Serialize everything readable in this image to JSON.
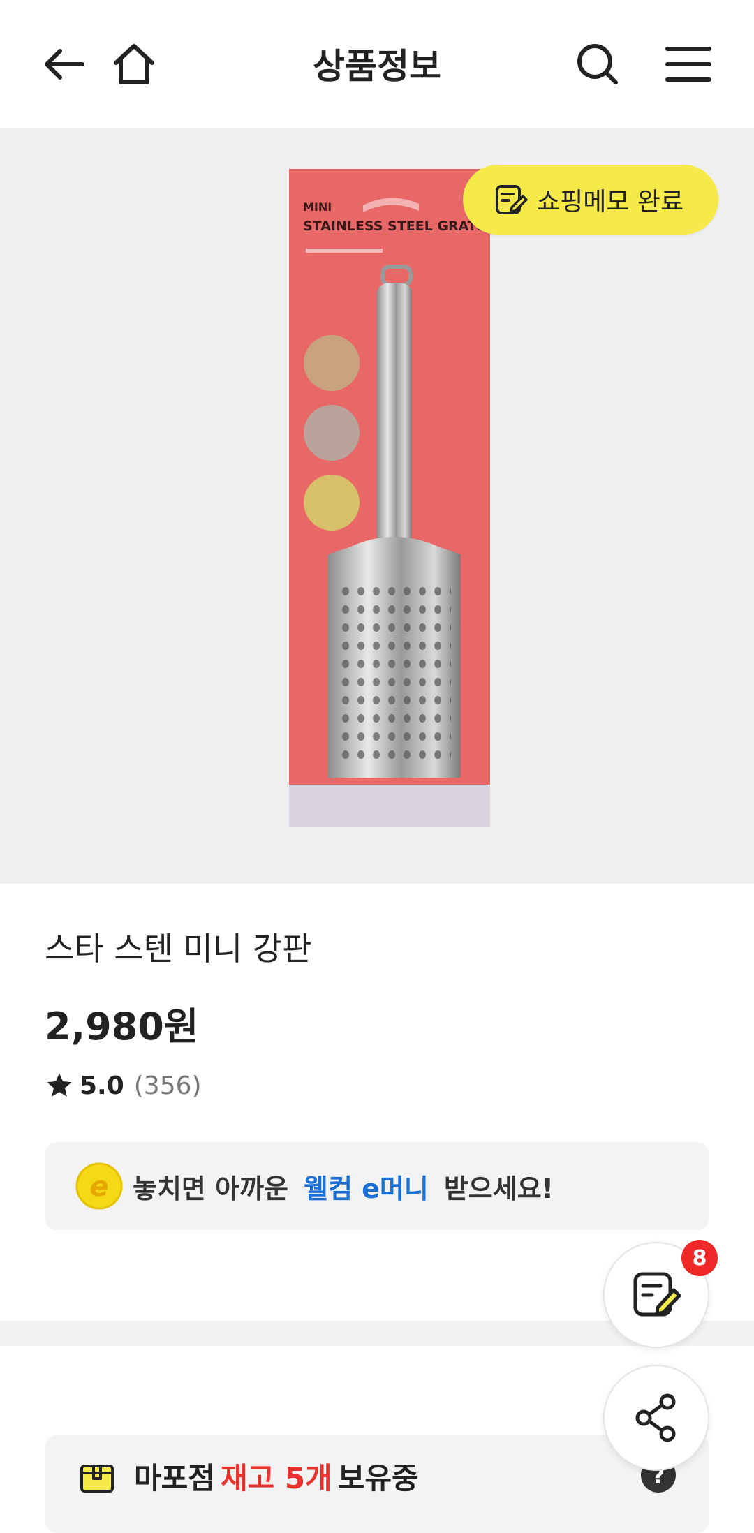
{
  "header": {
    "title": "상품정보",
    "back_icon": "arrow-left-icon",
    "home_icon": "home-icon",
    "search_icon": "search-icon",
    "menu_icon": "hamburger-menu-icon"
  },
  "hero": {
    "package_text_line1": "MINI",
    "package_text_line2": "STAINLESS STEEL GRATER",
    "memo_button_label": "쇼핑메모 완료",
    "memo_button_color": "#f6e94a"
  },
  "product": {
    "name": "스타 스텐 미니 강판",
    "price": "2,980원",
    "rating_score": "5.0",
    "rating_count": "(356)"
  },
  "welcome": {
    "coin_letter": "e",
    "text_before": "놓치면 아까운",
    "highlight": "웰컴 e머니",
    "text_after": "받으세요!",
    "highlight_color": "#1a6fd6"
  },
  "store": {
    "store_name": "마포점",
    "stock_text": "재고 5개",
    "status_text": "보유중",
    "stock_color": "#e8312d"
  },
  "floating": {
    "memo_badge_count": "8",
    "memo_icon": "shopping-memo-icon",
    "share_icon": "share-icon"
  }
}
